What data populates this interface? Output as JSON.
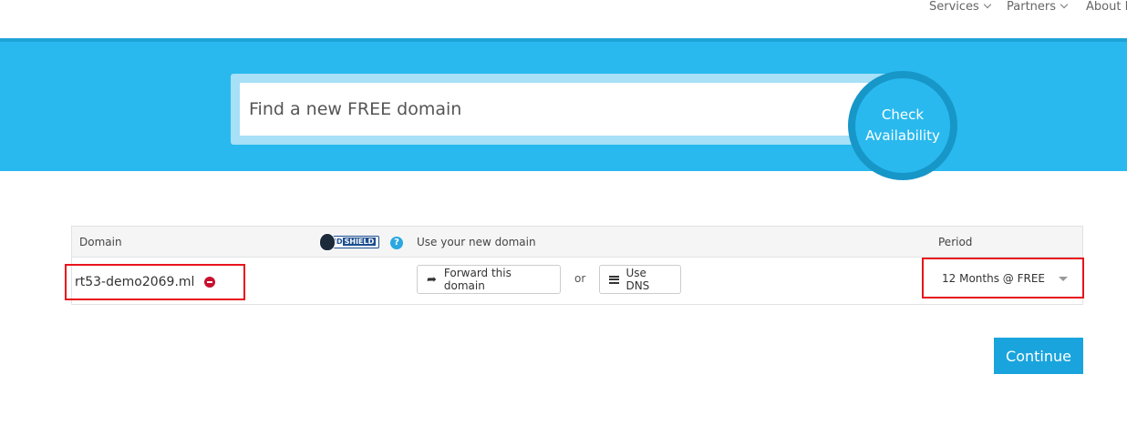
{
  "nav": {
    "items": [
      {
        "label": "Services"
      },
      {
        "label": "Partners"
      },
      {
        "label": "About I"
      }
    ]
  },
  "search": {
    "placeholder": "Find a new FREE domain",
    "button_label_line1": "Check",
    "button_label_line2": "Availability"
  },
  "table": {
    "headers": {
      "domain": "Domain",
      "use": "Use your new domain",
      "period": "Period"
    },
    "idshield": {
      "id": "ID",
      "shield": "SHIELD"
    },
    "help_icon": "?",
    "row": {
      "domain": "rt53-demo2069.ml",
      "forward_label": "Forward this domain",
      "or_label": "or",
      "dns_label": "Use DNS",
      "period_value": "12 Months @ FREE"
    }
  },
  "continue_label": "Continue",
  "colors": {
    "hero": "#29b9ee",
    "accent_button": "#1aa4dd",
    "highlight_border": "#e8131c",
    "remove_icon": "#c8102e"
  },
  "icons": [
    "chevron-down-icon",
    "remove-icon",
    "forward-arrow-icon",
    "list-icon",
    "help-icon",
    "idshield-logo",
    "caret-down-icon"
  ]
}
